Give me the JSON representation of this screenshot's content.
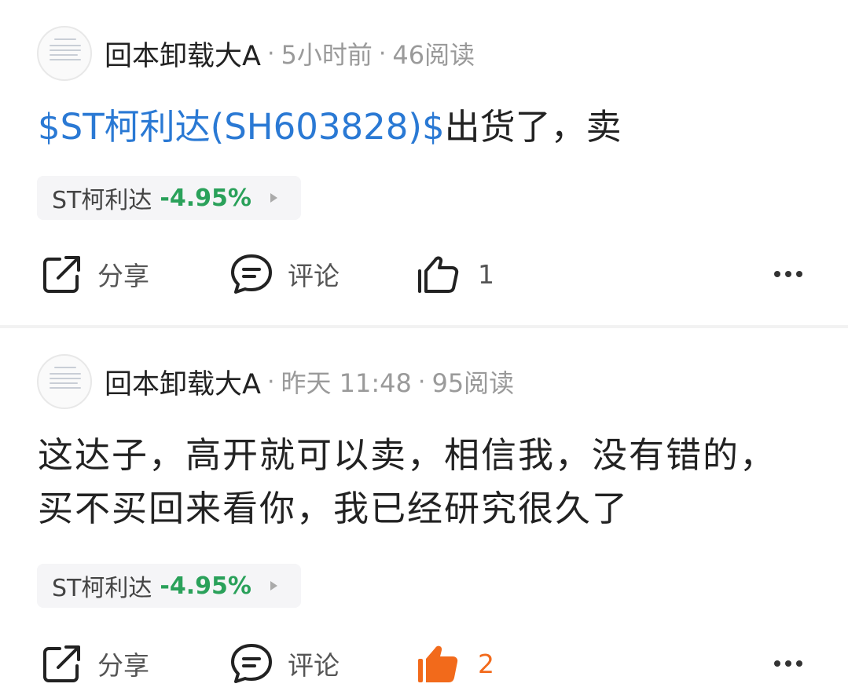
{
  "posts": [
    {
      "author": "回本卸载大A",
      "time": "5小时前",
      "reads": "46阅读",
      "content_link": "$ST柯利达(SH603828)$",
      "content_text": "出货了，卖",
      "stock_tag": {
        "name": "ST柯利达",
        "change": "-4.95%"
      },
      "actions": {
        "share": "分享",
        "comment": "评论",
        "like_count": "1",
        "liked": false
      }
    },
    {
      "author": "回本卸载大A",
      "time": "昨天 11:48",
      "reads": "95阅读",
      "content_text": "这达子，高开就可以卖，相信我，没有错的，买不买回来看你，我已经研究很久了",
      "stock_tag": {
        "name": "ST柯利达",
        "change": "-4.95%"
      },
      "actions": {
        "share": "分享",
        "comment": "评论",
        "like_count": "2",
        "liked": true
      }
    }
  ],
  "colors": {
    "link": "#2a79d4",
    "negative_change": "#2aa15a",
    "liked": "#f26a1b"
  },
  "icons": [
    "share-icon",
    "comment-icon",
    "thumbs-up-icon",
    "more-icon"
  ]
}
